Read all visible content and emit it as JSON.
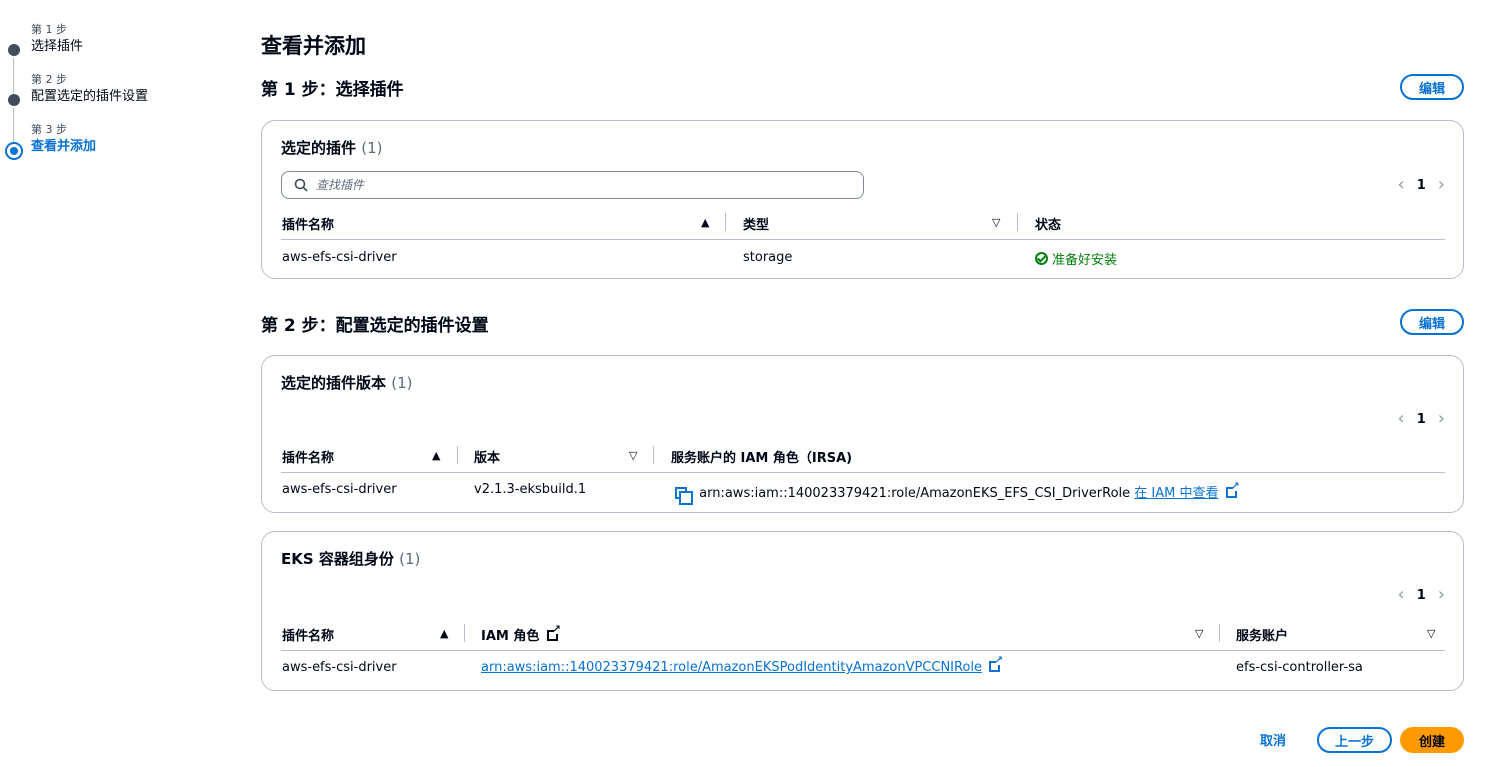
{
  "stepper": {
    "steps": [
      {
        "number": "第 1 步",
        "title": "选择插件"
      },
      {
        "number": "第 2 步",
        "title": "配置选定的插件设置"
      },
      {
        "number": "第 3 步",
        "title": "查看并添加"
      }
    ]
  },
  "page_title": "查看并添加",
  "edit_label": "编辑",
  "step1": {
    "title": "第 1 步：选择插件",
    "card": {
      "title": "选定的插件",
      "count": "(1)",
      "search_placeholder": "查找插件",
      "page": "1",
      "headers": [
        "插件名称",
        "类型",
        "状态"
      ],
      "row": {
        "name": "aws-efs-csi-driver",
        "type": "storage",
        "status": "准备好安装"
      }
    }
  },
  "step2": {
    "title": "第 2 步：配置选定的插件设置",
    "versions_card": {
      "title": "选定的插件版本",
      "count": "(1)",
      "page": "1",
      "headers": [
        "插件名称",
        "版本",
        "服务账户的 IAM 角色（IRSA)"
      ],
      "row": {
        "name": "aws-efs-csi-driver",
        "version": "v2.1.3-eksbuild.1",
        "role_arn": "arn:aws:iam::140023379421:role/AmazonEKS_EFS_CSI_DriverRole",
        "view_link": "在 IAM 中查看"
      }
    },
    "identity_card": {
      "title": "EKS 容器组身份",
      "count": "(1)",
      "page": "1",
      "headers": [
        "插件名称",
        "IAM 角色",
        "服务账户"
      ],
      "row": {
        "name": "aws-efs-csi-driver",
        "role_arn": "arn:aws:iam::140023379421:role/AmazonEKSPodIdentityAmazonVPCCNIRole",
        "service_account": "efs-csi-controller-sa"
      }
    }
  },
  "footer": {
    "cancel": "取消",
    "previous": "上一步",
    "create": "创建"
  },
  "colors": {
    "accent": "#0972d3",
    "primary_button": "#ff9900",
    "success": "#037f0c"
  }
}
